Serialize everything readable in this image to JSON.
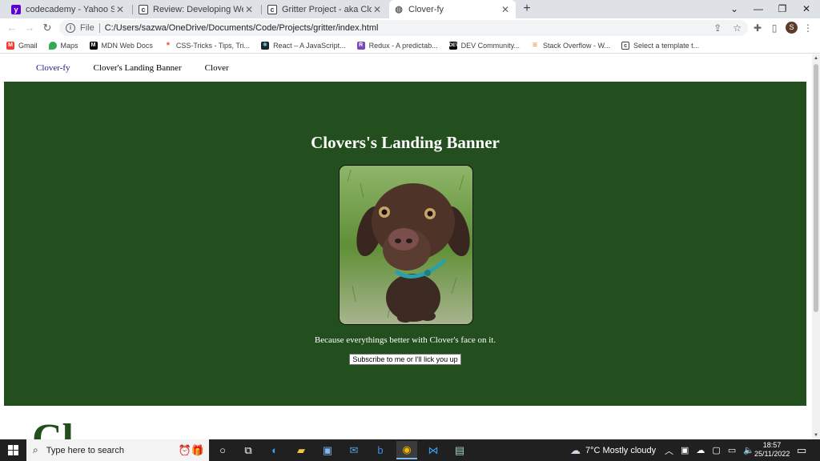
{
  "browser": {
    "tabs": [
      {
        "title": "codecademy - Yahoo Search Res",
        "icon": "yahoo-icon",
        "color": "#6001d2",
        "glyph": "y"
      },
      {
        "title": "Review: Developing Websites Lo",
        "icon": "codecademy-icon",
        "color": "#3c4043",
        "glyph": "c"
      },
      {
        "title": "Gritter Project - aka Clover - Co",
        "icon": "codecademy-icon",
        "color": "#3c4043",
        "glyph": "c"
      },
      {
        "title": "Clover-fy",
        "icon": "globe-icon",
        "color": "#5f6368",
        "glyph": "◍"
      }
    ],
    "new_tab": "+",
    "address": {
      "scheme": "File",
      "url": "C:/Users/sazwa/OneDrive/Documents/Code/Projects/gritter/index.html"
    },
    "profile_initial": "S",
    "bookmarks": [
      {
        "label": "Gmail",
        "icon": "gmail-icon",
        "color": "#ea4335",
        "glyph": "M"
      },
      {
        "label": "Maps",
        "icon": "maps-pin-icon",
        "color": "#34a853",
        "glyph": "●"
      },
      {
        "label": "MDN Web Docs",
        "icon": "mdn-icon",
        "color": "#000000",
        "glyph": "M"
      },
      {
        "label": "CSS-Tricks - Tips, Tri...",
        "icon": "css-tricks-icon",
        "color": "#e2542b",
        "glyph": "*"
      },
      {
        "label": "React – A JavaScript...",
        "icon": "react-icon",
        "color": "#20232a",
        "glyph": "⚛"
      },
      {
        "label": "Redux - A predictab...",
        "icon": "redux-icon",
        "color": "#764abc",
        "glyph": "R"
      },
      {
        "label": "DEV Community...",
        "icon": "dev-icon",
        "color": "#000000",
        "glyph": "D"
      },
      {
        "label": "Stack Overflow - W...",
        "icon": "stackoverflow-icon",
        "color": "#f48024",
        "glyph": "S"
      },
      {
        "label": "Select a template t...",
        "icon": "codecademy-icon",
        "color": "#3c4043",
        "glyph": "c"
      }
    ]
  },
  "site": {
    "nav": [
      "Clover-fy",
      "Clover's Landing Banner",
      "Clover"
    ],
    "banner_title": "Clovers's Landing Banner",
    "tagline": "Because everythings better with Clover's face on it.",
    "subscribe_label": "Subscribe to me or I'll lick you up",
    "banner_color": "#234f1e",
    "partial_heading": "Cl"
  },
  "taskbar": {
    "search_placeholder": "Type here to search",
    "weather": "7°C  Mostly cloudy",
    "time": "18:57",
    "date": "25/11/2022"
  }
}
